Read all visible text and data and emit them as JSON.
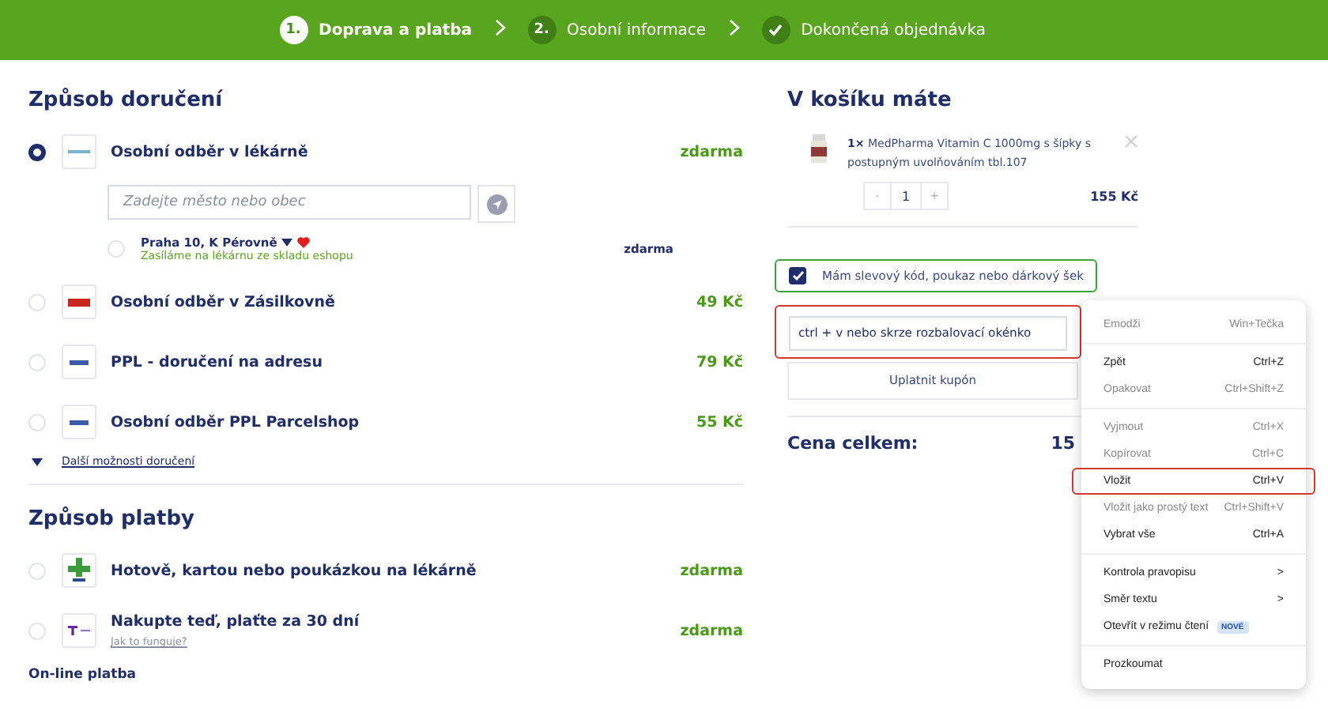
{
  "steps": [
    {
      "marker": "1.",
      "label": "Doprava a platba",
      "kind": "active"
    },
    {
      "marker": "2.",
      "label": "Osobní informace",
      "kind": "pending"
    },
    {
      "label": "Dokončená objednávka",
      "kind": "done"
    }
  ],
  "shipping": {
    "title": "Způsob doručení",
    "options": [
      {
        "name": "Osobní odběr v lékárně",
        "price": "zdarma",
        "selected": true,
        "kind": "pharmacy",
        "search": {
          "placeholder": "Zadejte město nebo obec"
        },
        "branch": {
          "name": "Praha 10, K Pérovně",
          "note": "Zasíláme na lékárnu ze skladu eshopu",
          "price": "zdarma",
          "selected": false
        }
      },
      {
        "name": "Osobní odběr v Zásilkovně",
        "price": "49 Kč",
        "selected": false,
        "kind": "zasilkovna"
      },
      {
        "name": "PPL - doručení na adresu",
        "price": "79 Kč",
        "selected": false,
        "kind": "ppl"
      },
      {
        "name": "Osobní odběr PPL Parcelshop",
        "price": "55 Kč",
        "selected": false,
        "kind": "ppl"
      }
    ],
    "more_link": "Další možnosti doručení"
  },
  "payment": {
    "title": "Způsob platby",
    "options": [
      {
        "name": "Hotově, kartou nebo poukázkou na lékárně",
        "price": "zdarma",
        "selected": false,
        "kind": "benu"
      },
      {
        "name": "Nakupte teď, plaťte za 30 dní",
        "link": "Jak to funguje?",
        "price": "zdarma",
        "selected": false,
        "kind": "twisto"
      }
    ],
    "subtitle": "On-line platba"
  },
  "cart": {
    "title": "V košíku máte",
    "item": {
      "qty_label": "1×",
      "name": "MedPharma Vitamin C 1000mg s šípky s postupným uvolňováním tbl.107",
      "minus": "-",
      "quantity": "1",
      "plus": "+",
      "price": "155 Kč"
    },
    "coupon_checkbox": {
      "label": "Mám slevový kód, poukaz nebo dárkový šek",
      "checked": true,
      "highlighted": true
    },
    "coupon_field": {
      "value": "ctrl + v nebo skrze rozbalovací okénko",
      "highlighted": true
    },
    "apply_button": "Uplatnit kupón",
    "total_label": "Cena celkem:",
    "total_value": "15"
  },
  "context_menu": {
    "groups": [
      [
        {
          "label": "Emodži",
          "shortcut": "Win+Tečka",
          "disabled": true,
          "highlighted": false
        }
      ],
      [
        {
          "label": "Zpět",
          "shortcut": "Ctrl+Z",
          "disabled": false,
          "highlighted": false
        },
        {
          "label": "Opakovat",
          "shortcut": "Ctrl+Shift+Z",
          "disabled": true,
          "highlighted": false
        }
      ],
      [
        {
          "label": "Vyjmout",
          "shortcut": "Ctrl+X",
          "disabled": true,
          "highlighted": false
        },
        {
          "label": "Kopírovat",
          "shortcut": "Ctrl+C",
          "disabled": true,
          "highlighted": false
        },
        {
          "label": "Vložit",
          "shortcut": "Ctrl+V",
          "disabled": false,
          "highlighted": true
        },
        {
          "label": "Vložit jako prostý text",
          "shortcut": "Ctrl+Shift+V",
          "disabled": true,
          "highlighted": false
        },
        {
          "label": "Vybrat vše",
          "shortcut": "Ctrl+A",
          "disabled": false,
          "highlighted": false
        }
      ],
      [
        {
          "label": "Kontrola pravopisu",
          "submenu": ">",
          "disabled": false,
          "highlighted": false
        },
        {
          "label": "Směr textu",
          "submenu": ">",
          "disabled": false,
          "highlighted": false
        },
        {
          "label": "Otevřít v režimu čtení",
          "badge": "NOVÉ",
          "disabled": false,
          "highlighted": false
        }
      ],
      [
        {
          "label": "Prozkoumat",
          "disabled": false,
          "highlighted": false
        }
      ]
    ]
  }
}
